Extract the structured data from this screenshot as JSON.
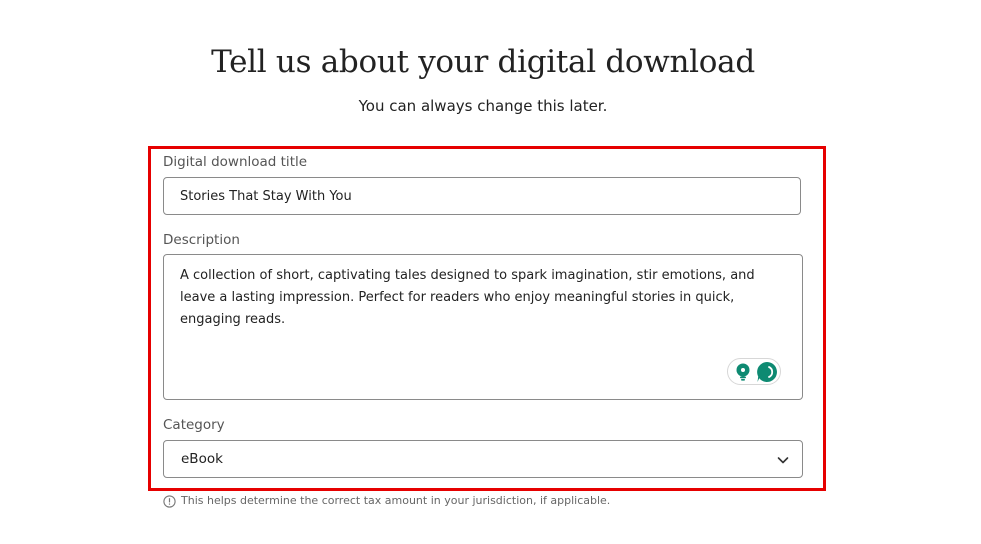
{
  "header": {
    "title": "Tell us about your digital download",
    "subtitle": "You can always change this later."
  },
  "form": {
    "title_field": {
      "label": "Digital download title",
      "value": "Stories That Stay With You"
    },
    "description_field": {
      "label": "Description",
      "value": "A collection of short, captivating tales designed to spark imagination, stir emotions, and leave a lasting impression. Perfect for readers who enjoy meaningful stories in quick, engaging reads."
    },
    "category_field": {
      "label": "Category",
      "selected": "eBook"
    },
    "help_text": "This helps determine the correct tax amount in your jurisdiction, if applicable."
  },
  "icons": {
    "writing_assistant": "lightbulb-icon",
    "chat_assistant": "chat-bubble-icon",
    "dropdown": "chevron-down-icon",
    "info": "info-circle-icon"
  },
  "colors": {
    "highlight_border": "#e60000",
    "assistant_accent": "#0e8a72"
  }
}
